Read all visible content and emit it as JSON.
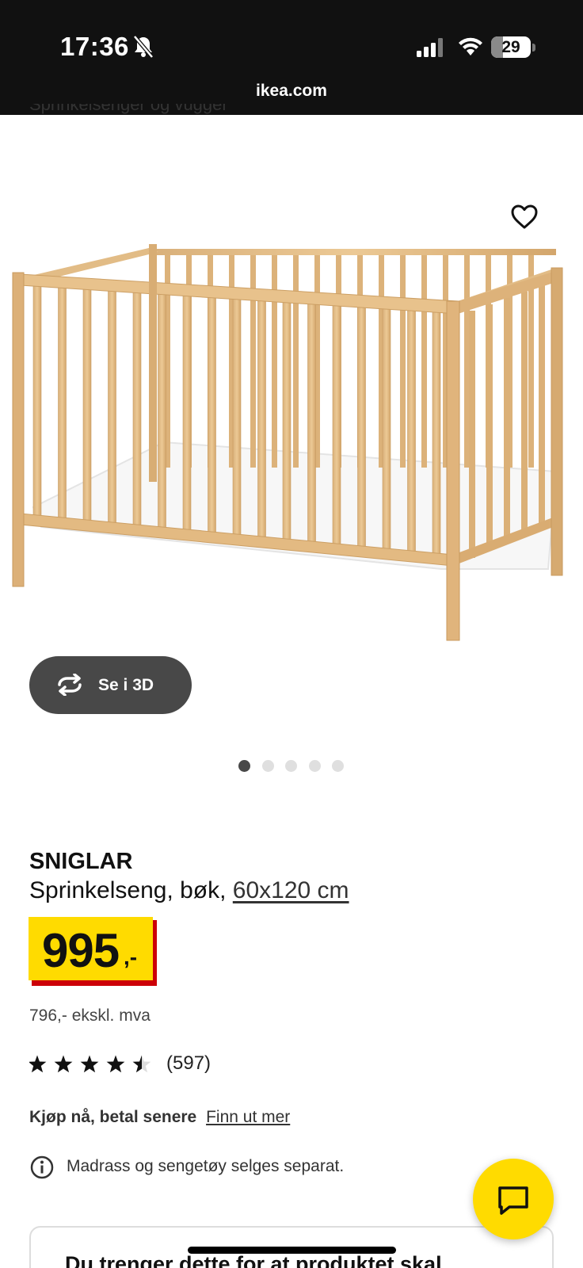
{
  "status_bar": {
    "time": "17:36",
    "battery_level": "29",
    "battery_fraction": 0.29,
    "icons": [
      "bell-slash-icon",
      "cellular-signal-icon",
      "wifi-icon",
      "battery-icon"
    ]
  },
  "browser": {
    "domain": "ikea.com"
  },
  "breadcrumb": {
    "label": "Sprinkelsenger og vugger"
  },
  "gallery": {
    "favorite_icon": "heart-outline-icon",
    "view3d_label": "Se i 3D",
    "view3d_icon": "rotate-3d-icon",
    "dots_total": 5,
    "dots_active_index": 0
  },
  "product": {
    "name": "SNIGLAR",
    "description": "Sprinkelseng, bøk, ",
    "size_link": "60x120 cm",
    "price_integer": "995",
    "price_suffix": ",-",
    "price_ex_vat": "796,- ekskl. mva",
    "rating_value": 4.5,
    "rating_max": 5,
    "rating_count": "(597)"
  },
  "financing": {
    "label": "Kjøp nå, betal senere",
    "link": "Finn ut mer"
  },
  "notice": {
    "icon": "info-circle-icon",
    "text": "Madrass og sengetøy selges separat."
  },
  "required_card": {
    "title": "Du trenger dette for at produktet skal"
  },
  "chat": {
    "icon": "chat-bubble-icon"
  },
  "colors": {
    "price_yellow": "#ffdb00",
    "price_red": "#cc0008",
    "button_dark": "#484848",
    "status_bar_bg": "#111111"
  }
}
